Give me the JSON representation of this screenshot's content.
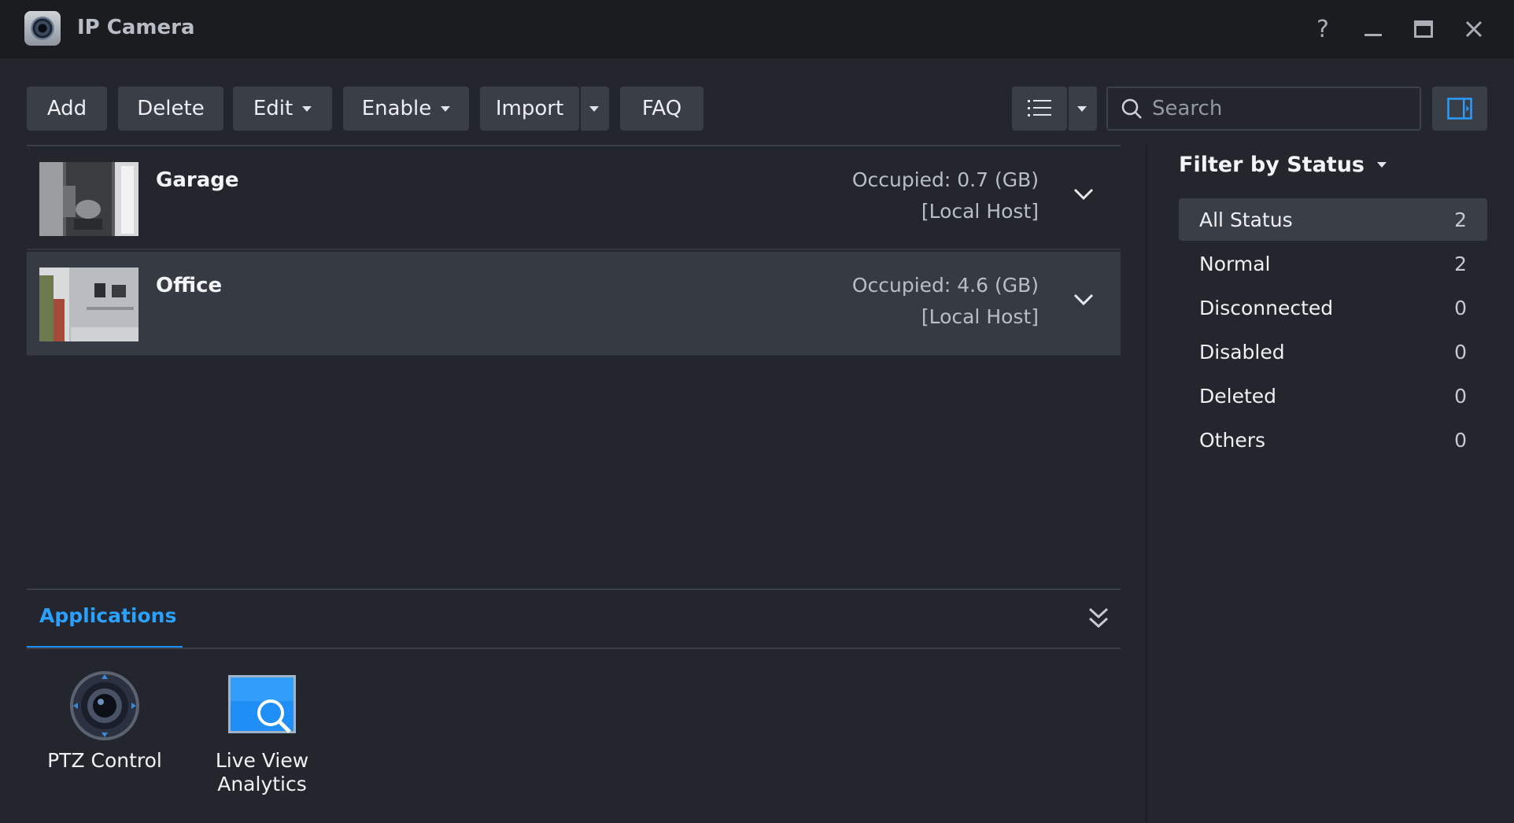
{
  "window": {
    "title": "IP Camera",
    "help_glyph": "?",
    "minimize_glyph": "—",
    "close_glyph": "✕"
  },
  "toolbar": {
    "add_label": "Add",
    "delete_label": "Delete",
    "edit_label": "Edit",
    "enable_label": "Enable",
    "import_label": "Import",
    "faq_label": "FAQ",
    "search_placeholder": "Search"
  },
  "cameras": [
    {
      "name": "Garage",
      "occupied": "Occupied: 0.7 (GB)",
      "host": "[Local Host]",
      "selected": false
    },
    {
      "name": "Office",
      "occupied": "Occupied: 4.6 (GB)",
      "host": "[Local Host]",
      "selected": true
    }
  ],
  "applications": {
    "tab_label": "Applications",
    "items": [
      {
        "label_line1": "PTZ Control",
        "label_line2": "",
        "icon": "ptz-control-icon"
      },
      {
        "label_line1": "Live View",
        "label_line2": "Analytics",
        "icon": "live-view-analytics-icon"
      }
    ]
  },
  "filter": {
    "title": "Filter by Status",
    "items": [
      {
        "label": "All Status",
        "count": "2",
        "active": true
      },
      {
        "label": "Normal",
        "count": "2",
        "active": false
      },
      {
        "label": "Disconnected",
        "count": "0",
        "active": false
      },
      {
        "label": "Disabled",
        "count": "0",
        "active": false
      },
      {
        "label": "Deleted",
        "count": "0",
        "active": false
      },
      {
        "label": "Others",
        "count": "0",
        "active": false
      }
    ]
  },
  "colors": {
    "accent": "#1e8cf0",
    "background": "#23262d",
    "titlebar": "#1a1c20",
    "button": "#3a3e46"
  }
}
